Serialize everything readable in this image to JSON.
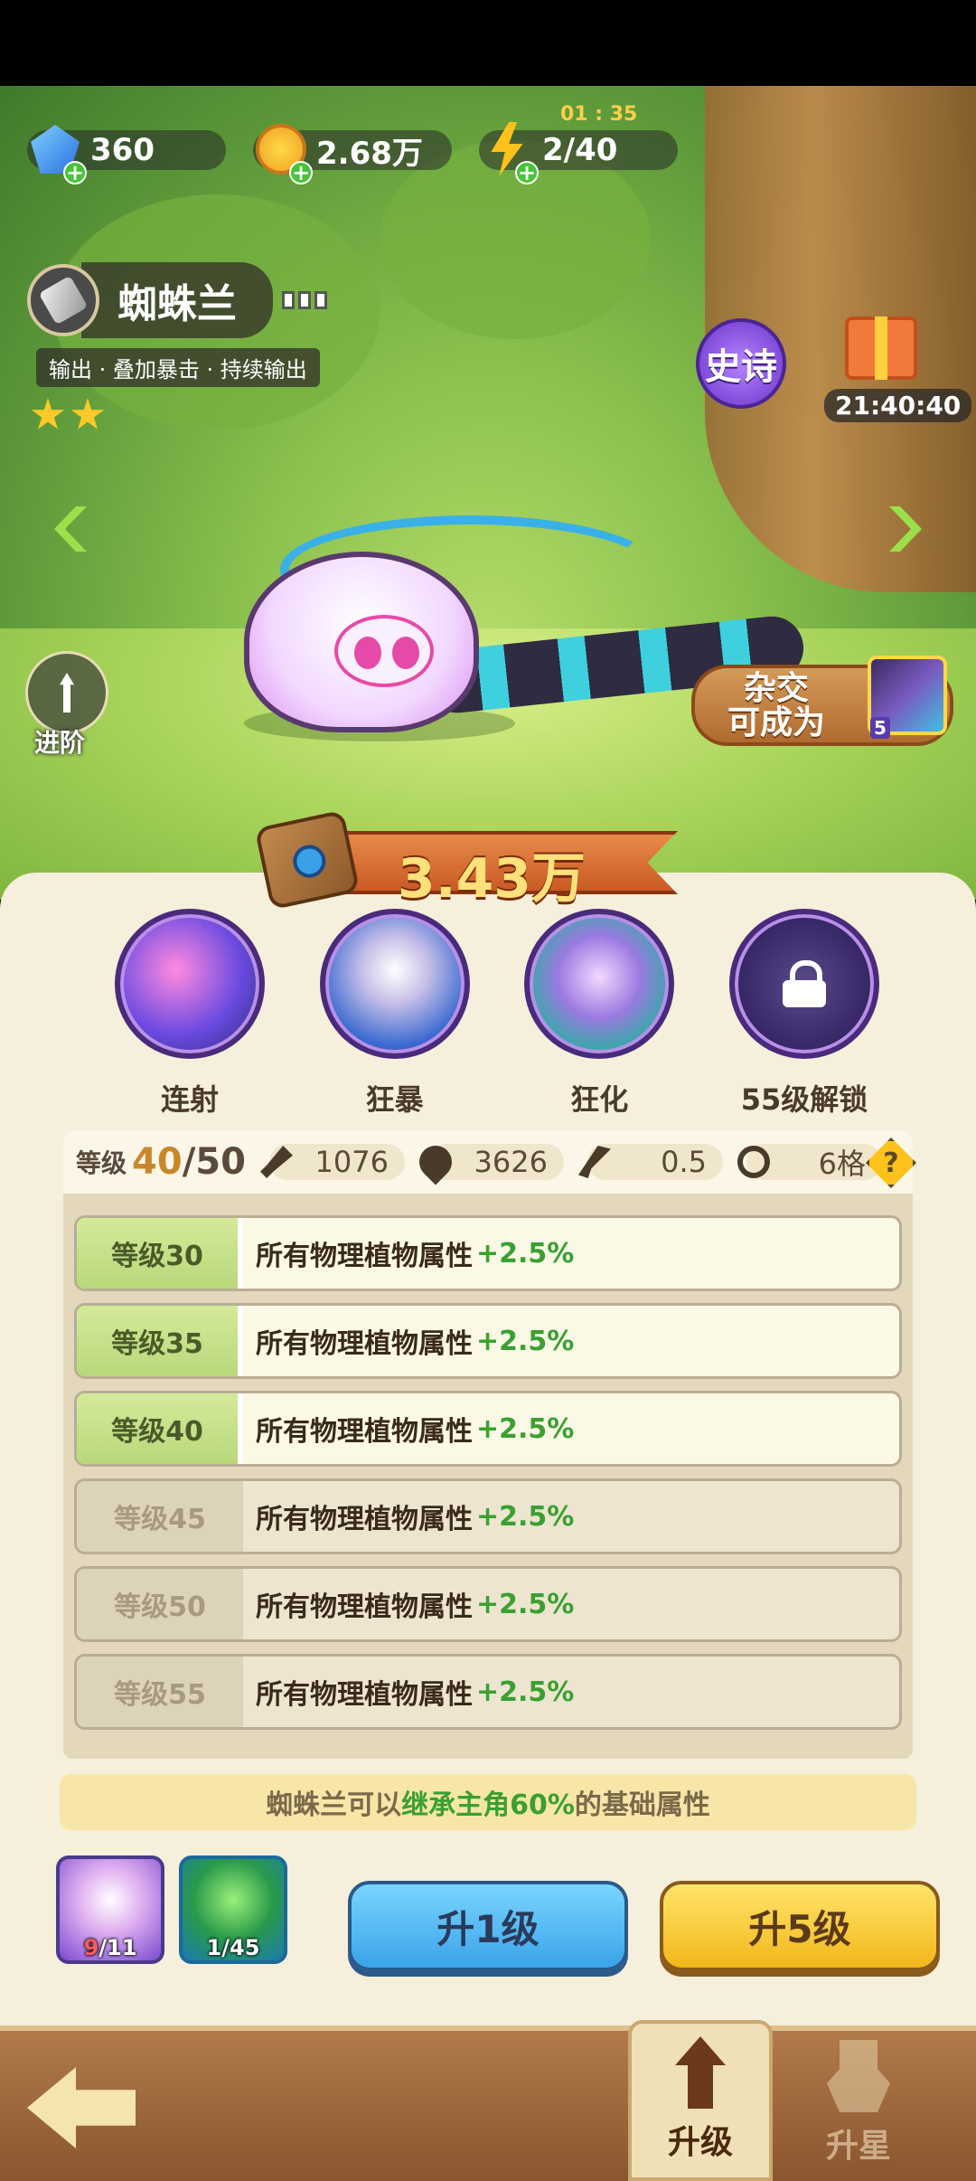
{
  "resources": {
    "gems": "360",
    "coins": "2.68万",
    "energy": "2/40",
    "energy_timer": "01 : 35"
  },
  "plant": {
    "name": "蜘蛛兰",
    "tags": "输出 · 叠加暴击 · 持续输出",
    "stars": 2,
    "rarity": "史诗"
  },
  "gift_timer": "21:40:40",
  "advance_label": "进阶",
  "hybrid": {
    "text_line1": "杂交",
    "text_line2": "可成为",
    "level": "5"
  },
  "power": "3.43万",
  "skills": [
    {
      "name": "连射",
      "icon": "rapid-shot-icon"
    },
    {
      "name": "狂暴",
      "icon": "berserk-icon"
    },
    {
      "name": "狂化",
      "icon": "frenzy-icon"
    },
    {
      "name": "55级解锁",
      "icon": "lock-icon"
    }
  ],
  "stats": {
    "level_label": "等级",
    "level_current": "40",
    "level_max": "/50",
    "attack": "1076",
    "hp": "3626",
    "speed": "0.5",
    "range": "6格",
    "help": "?"
  },
  "level_bonuses": [
    {
      "level": "等级30",
      "desc": "所有物理植物属性",
      "bonus": "+2.5%",
      "unlocked": true
    },
    {
      "level": "等级35",
      "desc": "所有物理植物属性",
      "bonus": "+2.5%",
      "unlocked": true
    },
    {
      "level": "等级40",
      "desc": "所有物理植物属性",
      "bonus": "+2.5%",
      "unlocked": true
    },
    {
      "level": "等级45",
      "desc": "所有物理植物属性",
      "bonus": "+2.5%",
      "unlocked": false
    },
    {
      "level": "等级50",
      "desc": "所有物理植物属性",
      "bonus": "+2.5%",
      "unlocked": false
    },
    {
      "level": "等级55",
      "desc": "所有物理植物属性",
      "bonus": "+2.5%",
      "unlocked": false
    }
  ],
  "inherit": {
    "pre": "蜘蛛兰可以",
    "highlight": "继承主角60%",
    "post": "的基础属性"
  },
  "materials": [
    {
      "have": "9",
      "need": "/11"
    },
    {
      "have": "1",
      "need": "/45"
    }
  ],
  "buttons": {
    "up1": "升1级",
    "up5": "升5级"
  },
  "tabs": {
    "upgrade": "升级",
    "star": "升星"
  },
  "colors": {
    "accent_green": "#3aa030",
    "level_gold": "#c8882a",
    "blue_button": "#3aa4e8",
    "yellow_button": "#f2b71a"
  }
}
